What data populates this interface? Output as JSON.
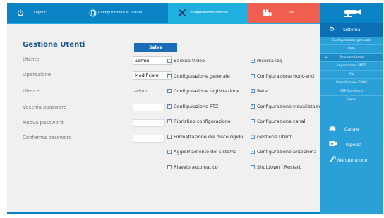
{
  "topbar": {
    "logout_label": "Logout",
    "pc_config_label": "Configurazione PC locale",
    "remote_config_label": "Configurazione remota",
    "live_label": "Live"
  },
  "page": {
    "title": "Gestione Utenti",
    "save_label": "Salva"
  },
  "form": {
    "user_label": "Utente",
    "user_value": "admin",
    "operation_label": "Operazione",
    "operation_value": "Modificare",
    "user2_label": "Utente",
    "user2_value": "admin",
    "old_password_label": "Vecchia password",
    "new_password_label": "Nuova password",
    "confirm_password_label": "Conferma password"
  },
  "permissions_left": [
    {
      "label": "Backup Video",
      "checked": true
    },
    {
      "label": "Configurazione generale",
      "checked": true
    },
    {
      "label": "Configurazione registrazione",
      "checked": true
    },
    {
      "label": "Configurazione PTZ",
      "checked": true
    },
    {
      "label": "Ripristino configurazione",
      "checked": true
    },
    {
      "label": "Formattazione del disco rigido",
      "checked": true
    },
    {
      "label": "Aggiornamento del sistema",
      "checked": true
    },
    {
      "label": "Riavvio automatico",
      "checked": true
    }
  ],
  "permissions_right": [
    {
      "label": "Ricerca log",
      "checked": true
    },
    {
      "label": "Configurazione front-end",
      "checked": true
    },
    {
      "label": "Rete",
      "checked": true
    },
    {
      "label": "Configurazione visualizzazione",
      "checked": true
    },
    {
      "label": "Configurazione canali",
      "checked": true
    },
    {
      "label": "Gestione Utenti",
      "checked": true
    },
    {
      "label": "Configurazione anteprima",
      "checked": true
    },
    {
      "label": "Shutdown / Restart",
      "checked": true
    }
  ],
  "sidebar": {
    "system_label": "Sistema",
    "system_items": [
      "Configurazione generale",
      "Rete",
      "Gestione Utenti",
      "Impostazioni SMTP",
      "Ftp",
      "Impostazione DDNS",
      "P2P Configura",
      "Upnp"
    ],
    "active_index": 2,
    "channel_label": "Canale",
    "recording_label": "Ripresa",
    "maintenance_label": "Manutenzione"
  },
  "colors": {
    "topbar_blue": "#0b84c6",
    "remote_tab": "#1fb0df",
    "live_tab": "#ef5e4e",
    "sidebar": "#2ba0d8",
    "title_blue": "#1a5a8a"
  },
  "icons": {
    "logout": "power-icon",
    "pc_config": "globe-icon",
    "remote_config": "wrench-screwdriver-icon",
    "live": "video-camera-icon",
    "brand": "cctv-camera-icon",
    "system": "gear-icon",
    "channel": "dome-camera-icon",
    "recording": "video-recorder-icon",
    "maintenance": "wrench-icon"
  }
}
